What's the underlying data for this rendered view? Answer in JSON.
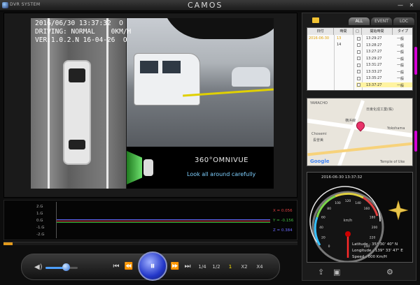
{
  "titlebar": {
    "app_label": "DVR SYSTEM",
    "brand": "CAMOS",
    "min": "—",
    "close": "✕"
  },
  "overlay": {
    "line1": "2016/06/30 13:37:32  O",
    "line2": "DRIVING: NORMAL    0KM/H",
    "line3": "VER:1.0.2.N 16-04-26  O"
  },
  "omni": {
    "logo": "360°OMNIVUE",
    "tagline": "Look all around carefully"
  },
  "graph": {
    "labels": [
      "2.G",
      "1.G",
      "0.G",
      "-1.G",
      "-2.G"
    ],
    "readouts": [
      {
        "text": "X = 0.056",
        "color": "#e04040"
      },
      {
        "text": "Y = -0.156",
        "color": "#40c040"
      },
      {
        "text": "Z = 0.384",
        "color": "#6a6aff"
      }
    ]
  },
  "playback": {
    "progress": 0.03,
    "volume": 0.62
  },
  "controls": {
    "prev_file": "⏮",
    "rewind": "⏪",
    "play": "⏸",
    "forward": "⏩",
    "next_file": "⏭",
    "speeds": [
      "1/4",
      "1/2",
      "1",
      "X2",
      "X4"
    ],
    "active_speed": "1"
  },
  "colors": {
    "accent": "#2337c9",
    "progress": "#e39a1c",
    "highlight": "#fff3a0",
    "scroll": "#d400d4"
  },
  "tabs": [
    "ALL",
    "EVENT",
    "LOC"
  ],
  "list": {
    "headers": [
      "日付",
      "時間",
      "□",
      "開始時間",
      "タイプ"
    ],
    "date": "2016-06-30",
    "hours": [
      "13",
      "14"
    ],
    "rows": [
      {
        "time": "13:29:27",
        "type": "一般"
      },
      {
        "time": "13:28:27",
        "type": "一般"
      },
      {
        "time": "13:27:27",
        "type": "一般"
      },
      {
        "time": "13:29:27",
        "type": "一般"
      },
      {
        "time": "13:31:27",
        "type": "一般"
      },
      {
        "time": "13:33:27",
        "type": "一般"
      },
      {
        "time": "13:35:27",
        "type": "一般"
      },
      {
        "time": "13:37:27",
        "type": "一般"
      }
    ]
  },
  "map": {
    "labels": [
      "YAMACHO",
      "日東化成工業(株)",
      "Chosemi",
      "長曽美",
      "Yokohama",
      "横浜線",
      "Temple of Uke"
    ]
  },
  "gauge": {
    "date": "2016-06-30  13:37:32",
    "latitude": "Latitude : 35°  30'  40\" N",
    "longitude": "Longitude : 139°  33'  47\" E",
    "speed": "Speed : 000 Km/H",
    "unit": "km/h",
    "ticks": [
      "0",
      "20",
      "40",
      "60",
      "80",
      "100",
      "120",
      "140",
      "160",
      "180",
      "200",
      "220",
      "240"
    ]
  }
}
